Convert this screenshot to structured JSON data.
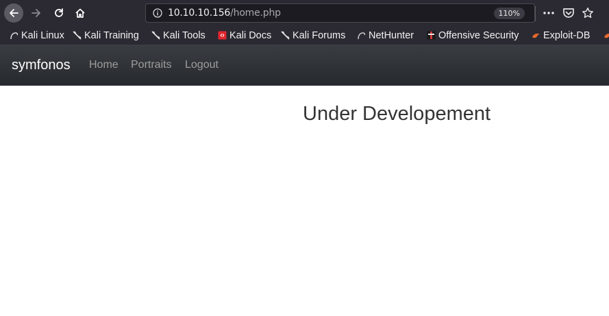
{
  "browser": {
    "url_host": "10.10.10.156",
    "url_path": "/home.php",
    "zoom": "110%"
  },
  "bookmarks": [
    {
      "label": "Kali Linux",
      "icon": "kali-dragon-icon"
    },
    {
      "label": "Kali Training",
      "icon": "kali-dragon-icon"
    },
    {
      "label": "Kali Tools",
      "icon": "kali-dragon-icon"
    },
    {
      "label": "Kali Docs",
      "icon": "kali-docs-icon"
    },
    {
      "label": "Kali Forums",
      "icon": "kali-dragon-icon"
    },
    {
      "label": "NetHunter",
      "icon": "nethunter-icon"
    },
    {
      "label": "Offensive Security",
      "icon": "offsec-icon"
    },
    {
      "label": "Exploit-DB",
      "icon": "exploitdb-icon"
    }
  ],
  "site": {
    "brand": "symfonos",
    "nav": [
      "Home",
      "Portraits",
      "Logout"
    ],
    "heading": "Under Developement"
  },
  "colors": {
    "toolbar_bg": "#2b2a33",
    "navbar_bg": "#2f3337",
    "nav_link": "#9d9d9d",
    "heading": "#333333"
  }
}
